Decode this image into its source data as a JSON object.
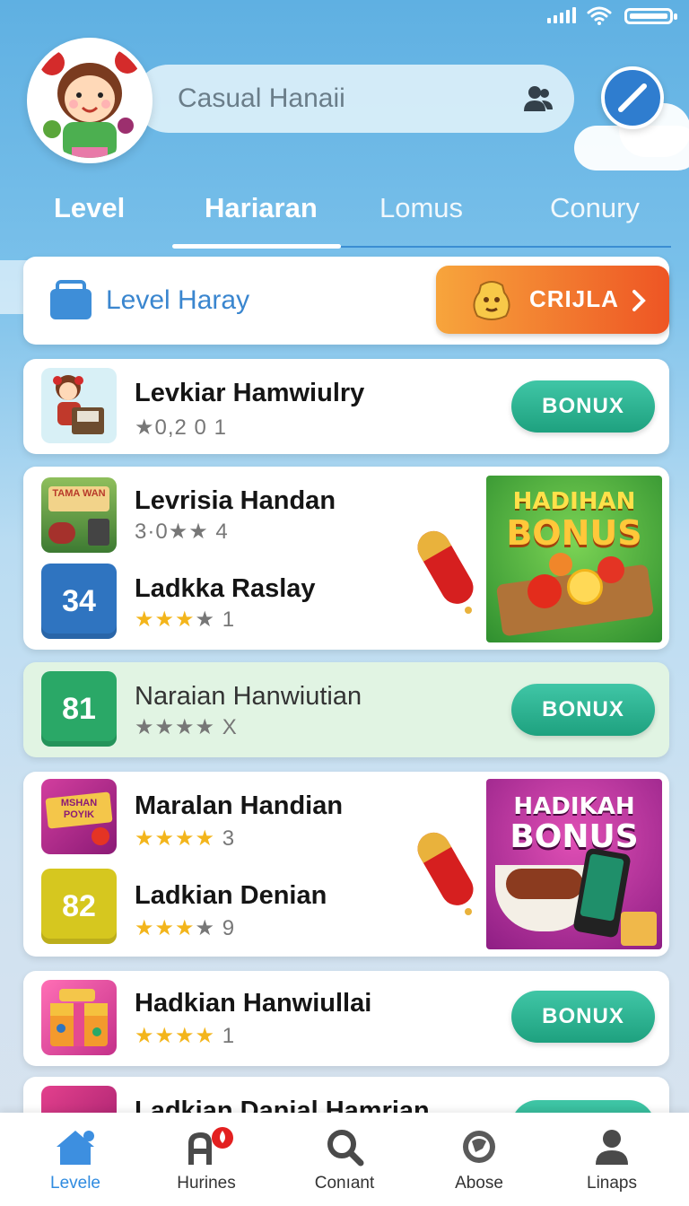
{
  "status": {
    "signal": "signal-icon",
    "wifi": "wifi-icon",
    "battery": "battery-icon"
  },
  "header": {
    "search_text": "Casual Hanaii"
  },
  "tabs": [
    {
      "label": "Level"
    },
    {
      "label": "Hariaran"
    },
    {
      "label": "Lomus"
    },
    {
      "label": "Conury"
    }
  ],
  "level_banner": {
    "title": "Level Haray",
    "button_label": "CRIJLA"
  },
  "items": [
    {
      "title": "Levkiar Hamwiulry",
      "rating": "★0,2 0 1",
      "button": "BONUX"
    },
    {
      "title": "Levrisia Handan",
      "rating_prefix": "3·0",
      "rating_stars": "★★",
      "rating_suffix": "4",
      "thumb_text": "TAMA WAN"
    },
    {
      "title": "Ladkka Raslay",
      "tile": "34",
      "rating_stars": "★★★",
      "rating_gray": "★",
      "rating_suffix": "1"
    },
    {
      "title": "Naraian Hanwiutian",
      "tile": "81",
      "rating": "★★★★ X",
      "button": "BONUX"
    },
    {
      "title": "Maralan Handian",
      "thumb_text": "MSHAN POYIK",
      "rating_stars": "★★★★",
      "rating_suffix": "3"
    },
    {
      "title": "Ladkian Denian",
      "tile": "82",
      "rating_stars": "★★★",
      "rating_gray": "★",
      "rating_suffix": "9"
    },
    {
      "title": "Hadkian Hanwiullai",
      "rating_stars": "★★★★",
      "rating_suffix": "1",
      "button": "BONUX"
    },
    {
      "title": "Ladkian Danial Hamrian"
    }
  ],
  "promos": [
    {
      "line1": "HADIHAN",
      "line2": "BONUS"
    },
    {
      "line1": "HADIKAH",
      "line2": "BONUS"
    }
  ],
  "bottom_nav": [
    {
      "label": "Levele",
      "icon": "home-icon"
    },
    {
      "label": "Hurines",
      "icon": "badge-icon"
    },
    {
      "label": "Conıant",
      "icon": "search-icon"
    },
    {
      "label": "Abose",
      "icon": "globe-icon"
    },
    {
      "label": "Linaps",
      "icon": "profile-icon"
    }
  ],
  "colors": {
    "accent": "#2f8be0",
    "bonus": "#2bb392",
    "orange": "#f07a24"
  }
}
